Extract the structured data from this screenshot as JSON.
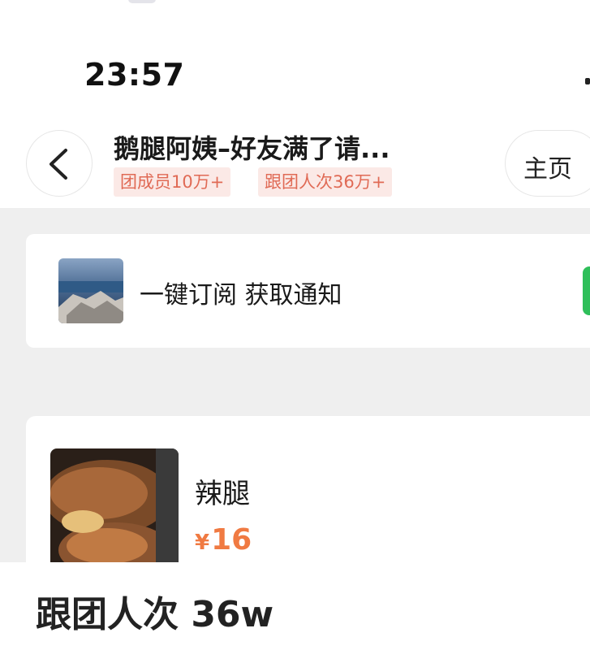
{
  "status_bar": {
    "time": "23:57"
  },
  "header": {
    "title": "鹅腿阿姨–好友满了请...",
    "tags": {
      "members": "团成员10万+",
      "join_times": "跟团人次36万+"
    },
    "home_label": "主页"
  },
  "subscribe": {
    "label": "一键订阅 获取通知"
  },
  "product": {
    "name": "辣腿",
    "currency": "¥",
    "price": "16"
  },
  "caption": {
    "text": "跟团人次 36w"
  },
  "colors": {
    "accent_price": "#f07a42",
    "tag_bg": "#fbe9e6",
    "tag_text": "#e06a55",
    "subscribe_green": "#2fbf5a"
  },
  "icons": {
    "back": "chevron-left-icon"
  }
}
